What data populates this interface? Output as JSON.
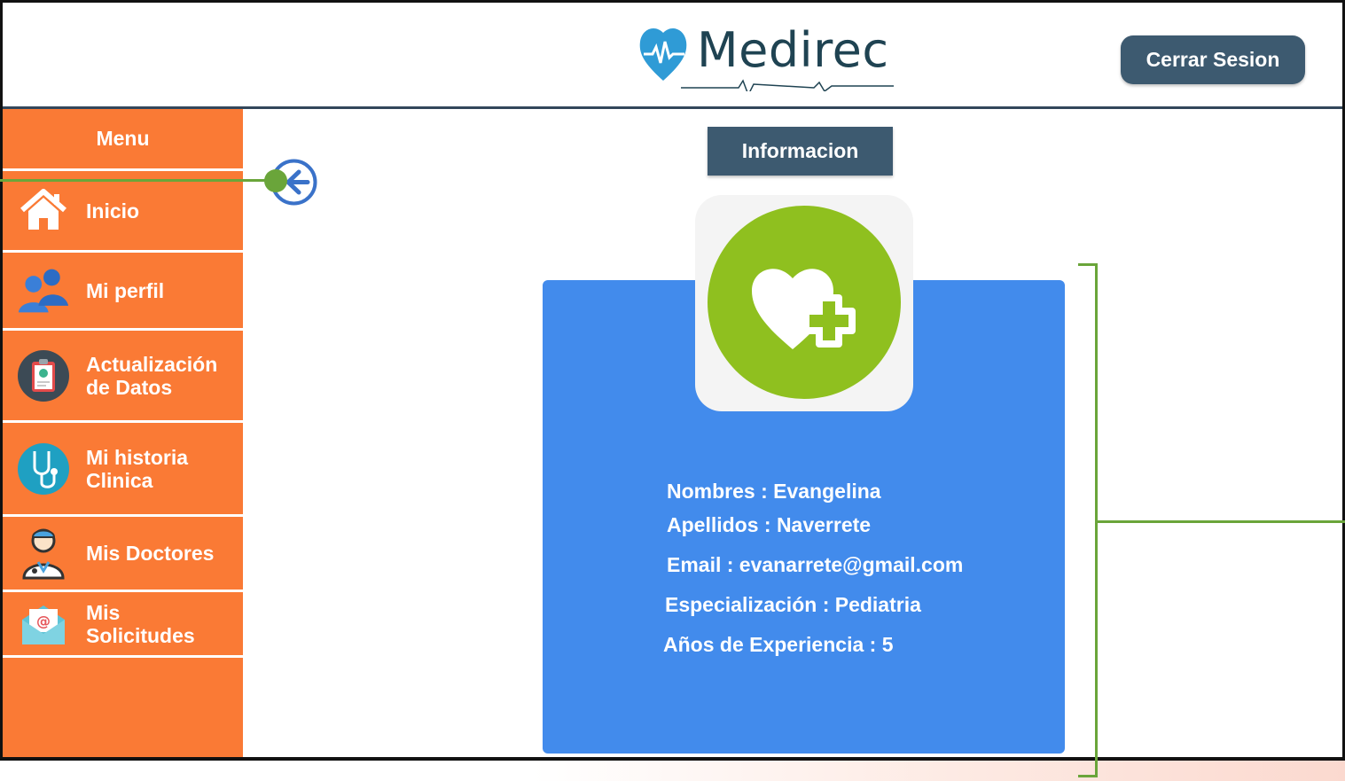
{
  "header": {
    "logo_text": "Medirec",
    "logout_label": "Cerrar Sesion"
  },
  "sidebar": {
    "title": "Menu",
    "items": [
      {
        "label": "Inicio",
        "icon": "home-icon"
      },
      {
        "label": "Mi perfil",
        "icon": "users-icon"
      },
      {
        "label": "Actualización\nde Datos",
        "icon": "clipboard-icon"
      },
      {
        "label": "Mi historia\nClinica",
        "icon": "stethoscope-icon"
      },
      {
        "label": "Mis Doctores",
        "icon": "doctor-icon"
      },
      {
        "label": "Mis\nSolicitudes",
        "icon": "envelope-icon"
      }
    ]
  },
  "main": {
    "info_label": "Informacion",
    "profile": {
      "nombres": "Nombres : Evangelina",
      "apellidos": "Apellidos : Naverrete",
      "email": "Email : evanarrete@gmail.com",
      "especializacion": "Especialización : Pediatria",
      "experiencia": "Años de Experiencia : 5"
    }
  },
  "colors": {
    "sidebar": "#fa7a35",
    "button": "#3d5a70",
    "card": "#428bec",
    "avatar": "#8fc01f",
    "annotation": "#6aa53a"
  }
}
